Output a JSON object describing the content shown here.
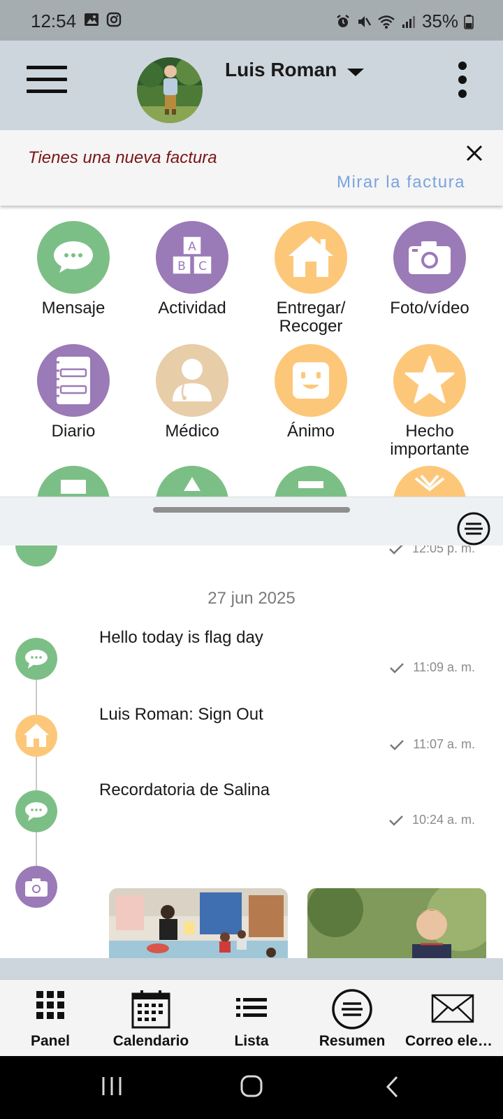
{
  "status_bar": {
    "time": "12:54",
    "battery": "35%"
  },
  "header": {
    "child_name": "Luis Roman"
  },
  "notice": {
    "message": "Tienes una nueva factura",
    "link": "Mirar la factura"
  },
  "actions": [
    {
      "label": "Mensaje",
      "icon": "message-icon",
      "color": "#7cbf86"
    },
    {
      "label": "Actividad",
      "icon": "abc-blocks-icon",
      "color": "#9b7ab8"
    },
    {
      "label": "Entregar/ Recoger",
      "icon": "house-icon",
      "color": "#fdc77a"
    },
    {
      "label": "Foto/vídeo",
      "icon": "camera-icon",
      "color": "#9b7ab8"
    },
    {
      "label": "Diario",
      "icon": "notebook-icon",
      "color": "#9b7ab8"
    },
    {
      "label": "Médico",
      "icon": "doctor-icon",
      "color": "#e8cda9"
    },
    {
      "label": "Ánimo",
      "icon": "smiley-icon",
      "color": "#fdc77a"
    },
    {
      "label": "Hecho importante",
      "icon": "star-icon",
      "color": "#fdc77a"
    }
  ],
  "feed": {
    "top_item_time": "12:05 p. m.",
    "date": "27 jun 2025",
    "items": [
      {
        "text": "Hello today is flag day",
        "time": "11:09 a. m.",
        "icon": "message-icon",
        "color": "#7cbf86"
      },
      {
        "text": "Luis Roman: Sign Out",
        "time": "11:07 a. m.",
        "icon": "house-icon",
        "color": "#fdc77a"
      },
      {
        "text": "Recordatoria de Salina",
        "time": "10:24 a. m.",
        "icon": "message-icon",
        "color": "#7cbf86"
      }
    ],
    "photo_entry_icon": "camera-icon"
  },
  "bottom_nav": [
    {
      "label": "Panel",
      "icon": "grid-icon"
    },
    {
      "label": "Calendario",
      "icon": "calendar-icon"
    },
    {
      "label": "Lista",
      "icon": "list-icon"
    },
    {
      "label": "Resumen",
      "icon": "summary-icon"
    },
    {
      "label": "Correo elect…",
      "icon": "envelope-icon"
    }
  ]
}
